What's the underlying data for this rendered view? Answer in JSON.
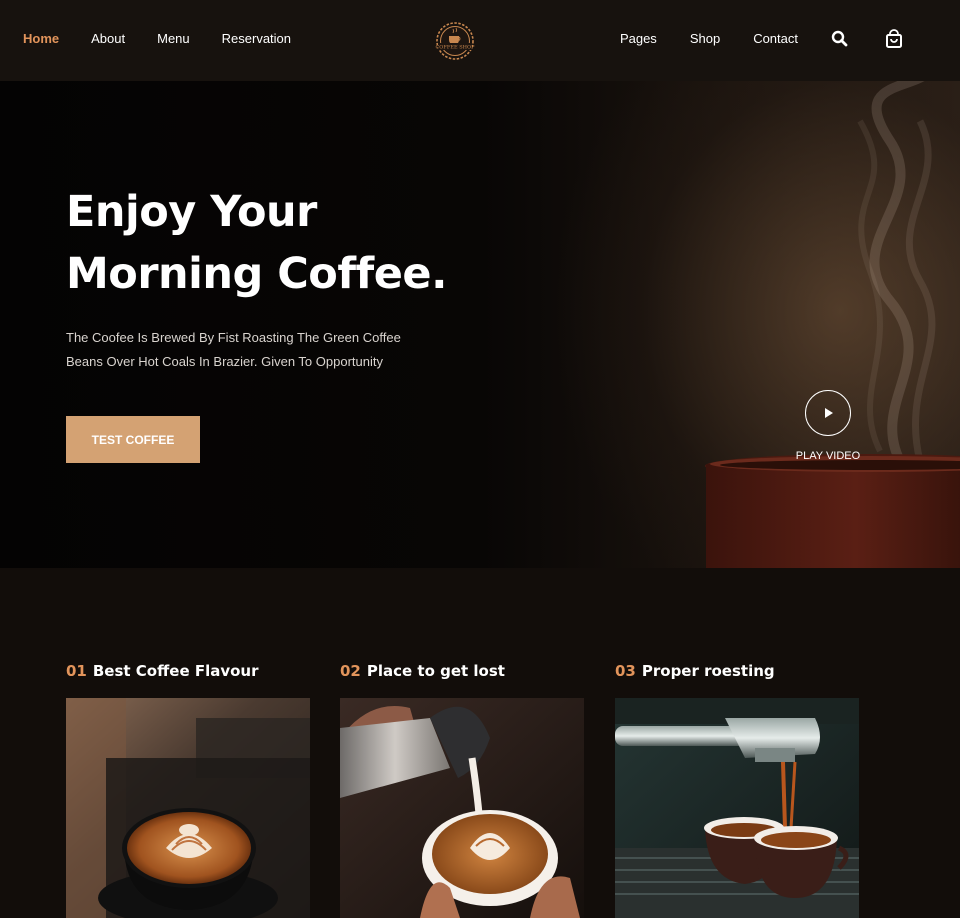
{
  "header": {
    "nav_left": [
      "Home",
      "About",
      "Menu",
      "Reservation"
    ],
    "nav_right": [
      "Pages",
      "Shop",
      "Contact"
    ],
    "logo_text": "COFFEE SHOP",
    "icons": [
      "search-icon",
      "shopping-bag-icon"
    ]
  },
  "hero": {
    "title_line1": "Enjoy Your",
    "title_line2": "Morning Coffee.",
    "desc_line1": "The Coofee Is Brewed By Fist Roasting The Green Coffee",
    "desc_line2": "Beans Over Hot Coals In Brazier. Given To Opportunity",
    "button_label": "TEST COFFEE",
    "play_label": "PLAY VIDEO"
  },
  "features": [
    {
      "num": "01",
      "title": "Best Coffee Flavour"
    },
    {
      "num": "02",
      "title": "Place to get lost"
    },
    {
      "num": "03",
      "title": "Proper roesting"
    }
  ],
  "colors": {
    "accent": "#e2945b",
    "button": "#d4a273",
    "header_bg": "#17120e",
    "page_bg": "#120d0a"
  }
}
